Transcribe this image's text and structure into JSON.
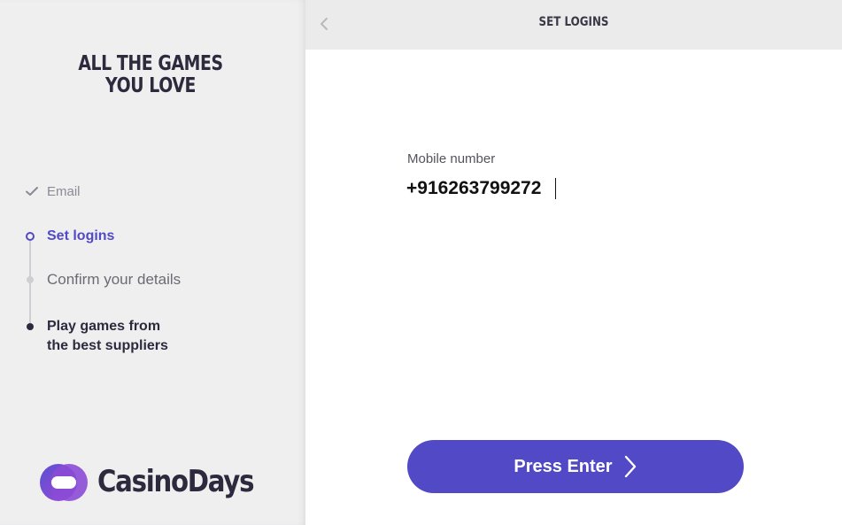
{
  "left_panel": {
    "headline": [
      "ALL THE GAMES",
      "YOU LOVE"
    ],
    "steps": [
      {
        "label": "Email",
        "state": "done"
      },
      {
        "label": "Set logins",
        "state": "active"
      },
      {
        "label": "Confirm your details",
        "state": "pending"
      },
      {
        "label": "Play games from the best suppliers",
        "lines": [
          "Play games from",
          "the best suppliers"
        ],
        "state": "final"
      }
    ],
    "brand": "CasinoDays"
  },
  "header": {
    "title": "SET LOGINS",
    "back_icon": "chevron-left-icon"
  },
  "form": {
    "mobile_label": "Mobile number",
    "mobile_value": "+916263799272"
  },
  "actions": {
    "enter_label": "Press Enter",
    "enter_icon": "chevron-right-icon"
  },
  "colors": {
    "accent": "#5149c6",
    "text_dark": "#2d2a3e",
    "panel_bg": "#efeff0",
    "header_bg": "#ebebec"
  }
}
